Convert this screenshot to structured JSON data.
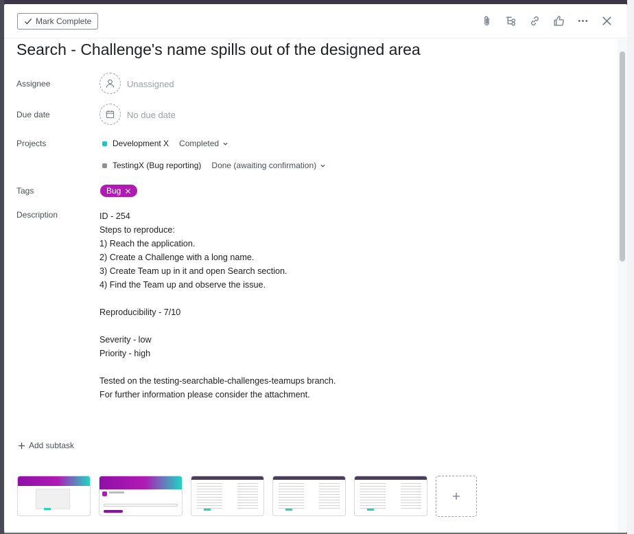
{
  "toolbar": {
    "mark_complete_label": "Mark Complete",
    "icons": [
      "paperclip-icon",
      "subtasks-icon",
      "link-icon",
      "like-icon",
      "more-icon",
      "close-icon"
    ]
  },
  "task": {
    "title": "Search - Challenge's name spills out of the designed area"
  },
  "fields": {
    "assignee_label": "Assignee",
    "assignee_value": "Unassigned",
    "due_label": "Due date",
    "due_value": "No due date",
    "projects_label": "Projects",
    "projects": [
      {
        "name": "Development X",
        "section": "Completed",
        "color": "#14c6c4"
      },
      {
        "name": "TestingX (Bug reporting)",
        "section": "Done (awaiting confirmation)",
        "color": "#8e8e95"
      }
    ],
    "tags_label": "Tags",
    "tags": [
      {
        "name": "Bug",
        "color": "#b219b5"
      }
    ],
    "description_label": "Description"
  },
  "description_lines": [
    "ID - 254",
    "Steps to reproduce:",
    "1) Reach the application.",
    "2) Create a Challenge with a long name.",
    "3) Create Team up in it and open Search section.",
    "4) Find the Team up and observe the issue.",
    "",
    "Reproducibility - 7/10",
    "",
    "Severity - low",
    "Priority - high",
    "",
    "Tested on the testing-searchable-challenges-teamups branch.",
    "For further information please consider the attachment."
  ],
  "subtask": {
    "add_label": "Add subtask"
  }
}
